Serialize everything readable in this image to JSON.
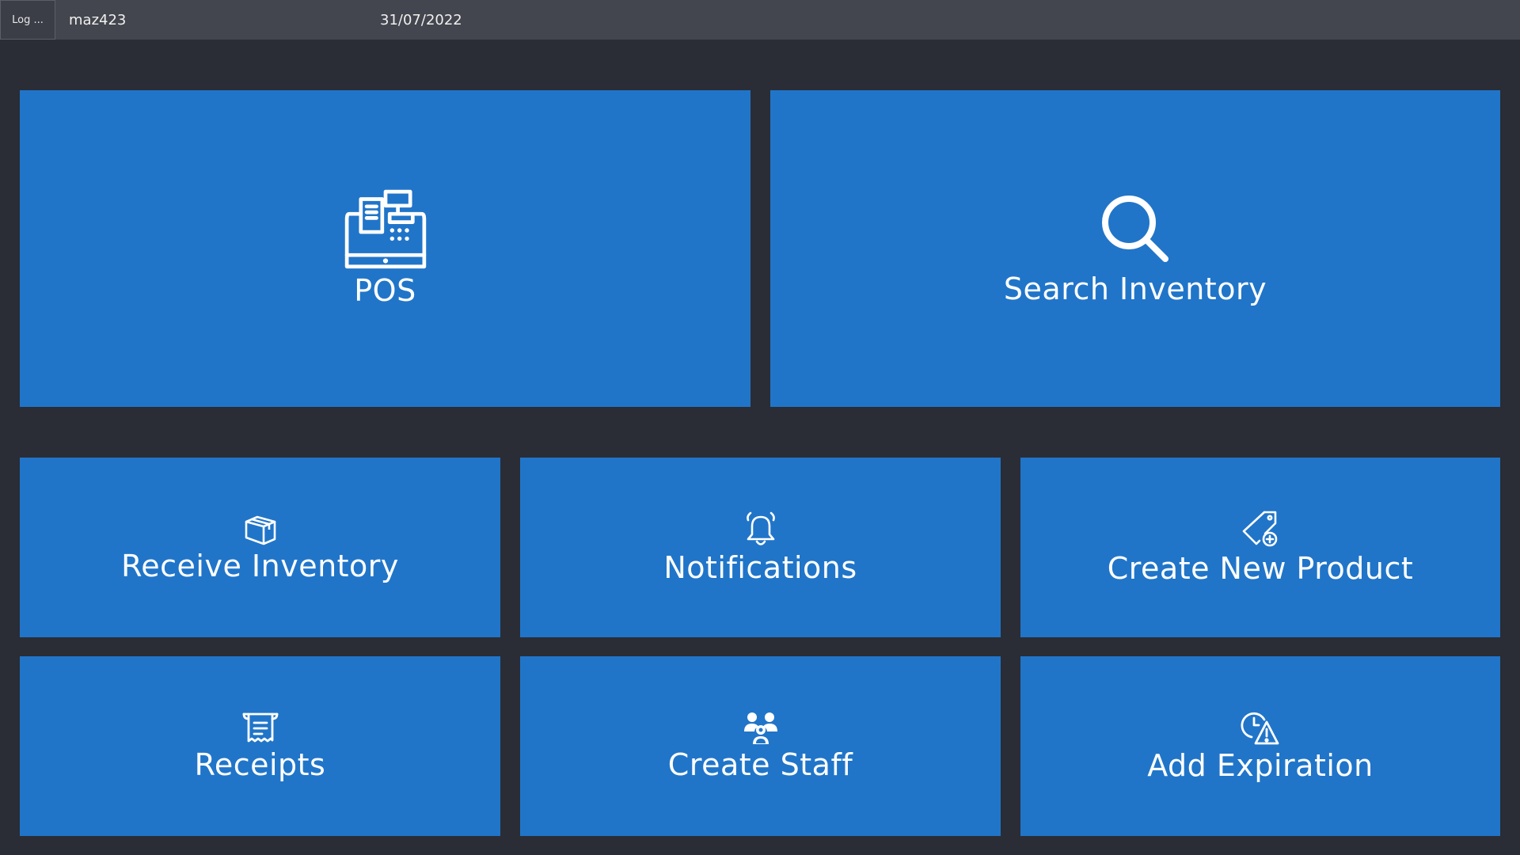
{
  "topbar": {
    "logout_label": "Log ...",
    "username": "maz423",
    "date": "31/07/2022"
  },
  "tiles": {
    "pos": {
      "label": "POS",
      "icon": "cash-register-icon"
    },
    "search": {
      "label": "Search Inventory",
      "icon": "search-icon"
    },
    "receive": {
      "label": "Receive Inventory",
      "icon": "box-icon"
    },
    "notifications": {
      "label": "Notifications",
      "icon": "bell-icon"
    },
    "create_product": {
      "label": "Create New Product",
      "icon": "tag-plus-icon"
    },
    "receipts": {
      "label": "Receipts",
      "icon": "receipt-scroll-icon"
    },
    "create_staff": {
      "label": "Create Staff",
      "icon": "users-icon"
    },
    "add_expiration": {
      "label": "Add Expiration",
      "icon": "clock-warning-icon"
    }
  },
  "colors": {
    "background": "#2a2d35",
    "topbar": "#43464e",
    "tile": "#2075c9",
    "text": "#ffffff"
  }
}
